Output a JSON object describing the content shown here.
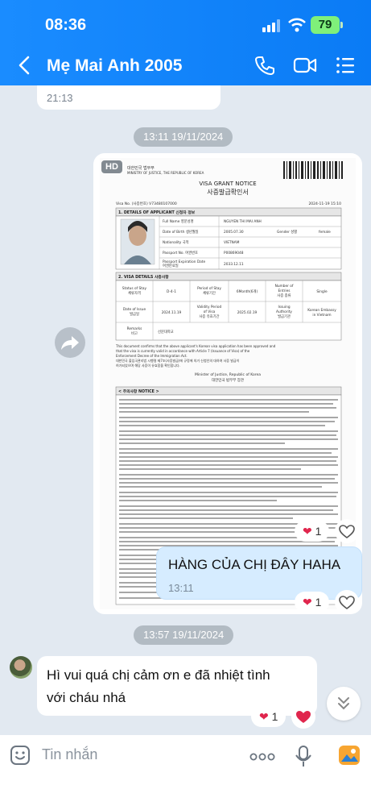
{
  "status_bar": {
    "time": "08:36",
    "battery": "79"
  },
  "header": {
    "title": "Mẹ Mai Anh 2005",
    "icons": [
      "back-arrow-icon",
      "phone-icon",
      "video-call-icon",
      "menu-list-icon"
    ]
  },
  "messages": {
    "prev_time": "21:13",
    "date_1": "13:11 19/11/2024",
    "image": {
      "hd_label": "HD",
      "document": {
        "ministry": "대한민국 법무부\nMINISTRY OF JUSTICE, THE REPUBLIC OF KOREA",
        "title_en": "VISA GRANT NOTICE",
        "title_ko": "사증발급확인서",
        "visa_no": "Visa No. (사증번호) V73480107000",
        "issue_datetime": "2024-11-19 15:10",
        "section1": "1. DETAILS OF APPLICANT 신청자 정보",
        "applicant_rows": [
          {
            "label": "Full Name 영문성명",
            "value": "NGUYEN THI MAI ANH"
          },
          {
            "label": "Date of Birth 생년월일",
            "value": "2005.07.30"
          },
          {
            "label": "Nationality 국적",
            "value": "VIETNAM"
          },
          {
            "label": "Passport No. 여권번호",
            "value": "P00869048"
          },
          {
            "label": "Passport Expiration Date 여권만료일",
            "value": "2033.12.11"
          }
        ],
        "gender_label": "Gender 성별",
        "gender_value": "female",
        "section2": "2. VISA DETAILS 사증사항",
        "visa_row1": [
          "Status of Stay 체류자격",
          "D-4-1",
          "Period of Stay 체류기간",
          "6Month(6개)",
          "Number of Entries 사증 종류",
          "Single"
        ],
        "visa_row2": [
          "Date of Issue 발급일",
          "2024.11.19",
          "Validity Period of Visa 사증 유효기간",
          "2025.02.19",
          "Issuing Authority 발급기관",
          "Korean Embassy in Vietnam"
        ],
        "remarks": [
          "Remarks 비고",
          "선문대학교"
        ],
        "statement": "This document confirms that the above applicant's Korean visa application has been approved and that the visa is currently valid in accordance with Article 7 (Issuance of Visa) of the Enforcement Decree of the Immigration Act.",
        "minister": "Minister of Justice, Republic of Korea\n대한민국 법무부 장관",
        "notice_header": "< 주의사항 NOTICE >"
      }
    },
    "image_reaction_count": "1",
    "sent_text": "HÀNG CỦA CHỊ ĐÂY HAHA",
    "sent_time": "13:11",
    "sent_reaction_count": "1",
    "date_2": "13:57 19/11/2024",
    "received_line1": "Hì vui quá  chị cảm ơn  e đã  nhiệt  tình",
    "received_line2": "với cháu  nhá",
    "received_reaction_count": "1"
  },
  "input_bar": {
    "placeholder": "Tin nhắn",
    "icons": [
      "sticker-icon",
      "more-dots-icon",
      "microphone-icon",
      "gallery-icon"
    ]
  },
  "colors": {
    "header": "#1a8cff",
    "sent_bubble": "#d6ecff",
    "background": "#e2e9f1",
    "heart": "#e0264d"
  }
}
